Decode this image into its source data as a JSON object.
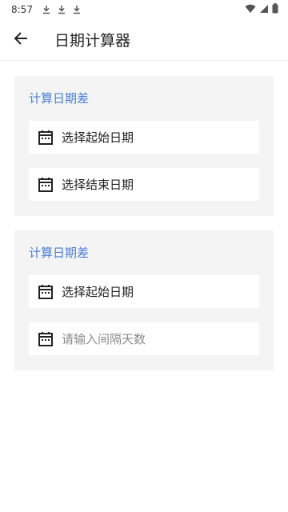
{
  "status_bar": {
    "time": "8:57",
    "download_icons": [
      "download-icon",
      "download-icon",
      "download-icon"
    ],
    "right_icons": [
      "wifi-icon",
      "signal-icon",
      "battery-icon"
    ]
  },
  "app_bar": {
    "back_icon": "arrow-left-icon",
    "title": "日期计算器"
  },
  "cards": [
    {
      "title": "计算日期差",
      "fields": [
        {
          "icon": "calendar-icon",
          "label": "选择起始日期"
        },
        {
          "icon": "calendar-icon",
          "label": "选择结束日期"
        }
      ]
    },
    {
      "title": "计算日期差",
      "fields": [
        {
          "icon": "calendar-icon",
          "label": "选择起始日期"
        },
        {
          "icon": "calendar-icon",
          "value": "",
          "placeholder": "请输入间隔天数"
        }
      ]
    }
  ],
  "colors": {
    "accent": "#4a7fd4",
    "card_bg": "#f4f4f4",
    "field_bg": "#ffffff"
  }
}
